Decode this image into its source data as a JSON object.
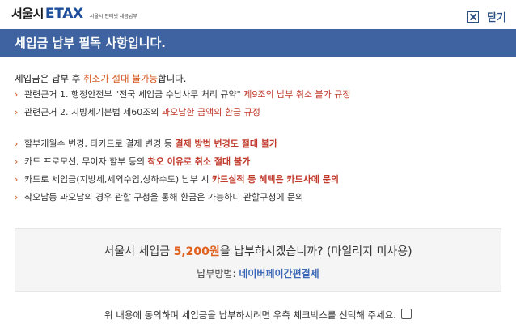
{
  "logo": {
    "ko": "서울시",
    "en": "ETAX",
    "sub": "서울시 인터넷 세금납부"
  },
  "close": {
    "label": "닫기"
  },
  "header": {
    "title": "세입금 납부 필독 사항입니다."
  },
  "intro": {
    "p1": "세입금은 납부 후 ",
    "p2": "취소가 절대 불가능",
    "p3": "합니다."
  },
  "list1": [
    {
      "a": "관련근거 1. 행정안전부 \"전국 세입금 수납사무 처리 규약\" ",
      "b": "제9조의 납부 취소 불가 규정"
    },
    {
      "a": "관련근거 2. 지방세기본법 제60조의 ",
      "b": "과오납한 금액의 환급 규정"
    }
  ],
  "list2": [
    {
      "a": "할부개월수 변경, 타카드로 결제 변경 등 ",
      "b": "결제 방법 변경도 절대 불가",
      "c": ""
    },
    {
      "a": "카드 프로모션, 무이자 할부 등의 ",
      "b": "착오 이유로 취소 절대 불가",
      "c": ""
    },
    {
      "a": "카드로 세입금(지방세,세외수입,상하수도) 납부 시 ",
      "b": "카드실적 등 혜택은 카드사에 문의",
      "c": ""
    },
    {
      "a": "착오납등 과오납의 경우 관할 구청을 통해 환급은 가능하니 관할구청에 문의",
      "b": "",
      "c": ""
    }
  ],
  "confirm": {
    "q1": "서울시 세입금 ",
    "amount": "5,200원",
    "q2": "을 납부하시겠습니까? (마일리지 미사용)",
    "method_label": "납부방법: ",
    "method_value": "네이버페이간편결제"
  },
  "agree": {
    "text": "위 내용에 동의하며 세입금을 납부하시려면 우측 체크박스를 선택해 주세요."
  },
  "colors": {
    "header_bg": "#3f63a0",
    "accent_orange": "#d4561c",
    "accent_red": "#c0392b",
    "link_blue": "#3a67b5"
  }
}
